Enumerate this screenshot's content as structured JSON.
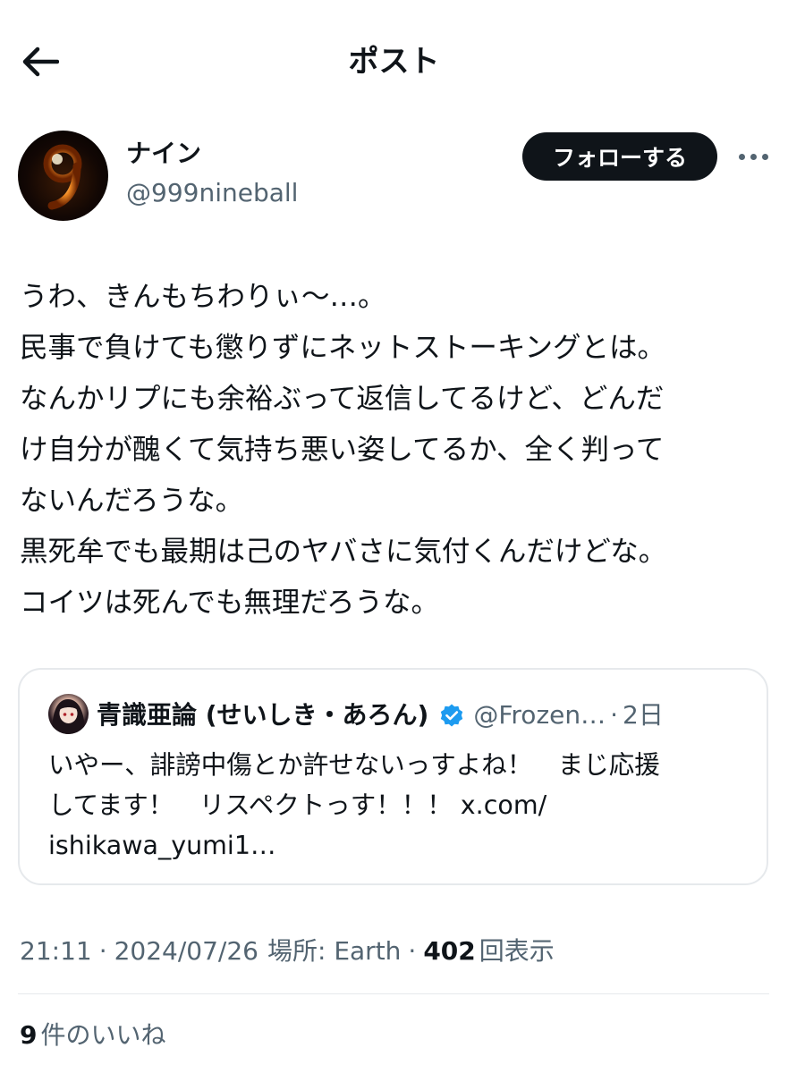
{
  "header": {
    "title": "ポスト",
    "back_icon": "arrow-left-icon"
  },
  "author": {
    "display_name": "ナイン",
    "handle": "@999nineball",
    "avatar_glyph": "9",
    "follow_label": "フォローする",
    "more_icon": "more-dots-icon"
  },
  "tweet": {
    "lines": [
      "うわ、きんもちわりぃ〜…。",
      "民事で負けても懲りずにネットストーキングとは。",
      "なんかリプにも余裕ぶって返信してるけど、どんだ",
      "け自分が醜くて気持ち悪い姿してるか、全く判って",
      "ないんだろうな。",
      "黒死牟でも最期は己のヤバさに気付くんだけどな。",
      "コイツは死んでも無理だろうな。"
    ]
  },
  "quote": {
    "name": "青識亜論 (せいしき・あろん)",
    "verified_icon": "verified-badge-icon",
    "handle": "@Frozen…",
    "separator": "·",
    "time": "2日",
    "lines": [
      "いやー、誹謗中傷とか許せないっすよね！　まじ応援",
      "してます！　リスペクトっす！！！ x.com/",
      "ishikawa_yumi1…"
    ]
  },
  "meta": {
    "time": "21:11",
    "sep1": "·",
    "date": "2024/07/26",
    "location": "場所: Earth",
    "sep2": "·",
    "views_count": "402",
    "views_label": "回表示"
  },
  "likes": {
    "count": "9",
    "label": "件のいいね"
  },
  "colors": {
    "text": "#0f1419",
    "secondary": "#536471",
    "verified": "#1d9bf0",
    "border": "#e6e9ec"
  }
}
